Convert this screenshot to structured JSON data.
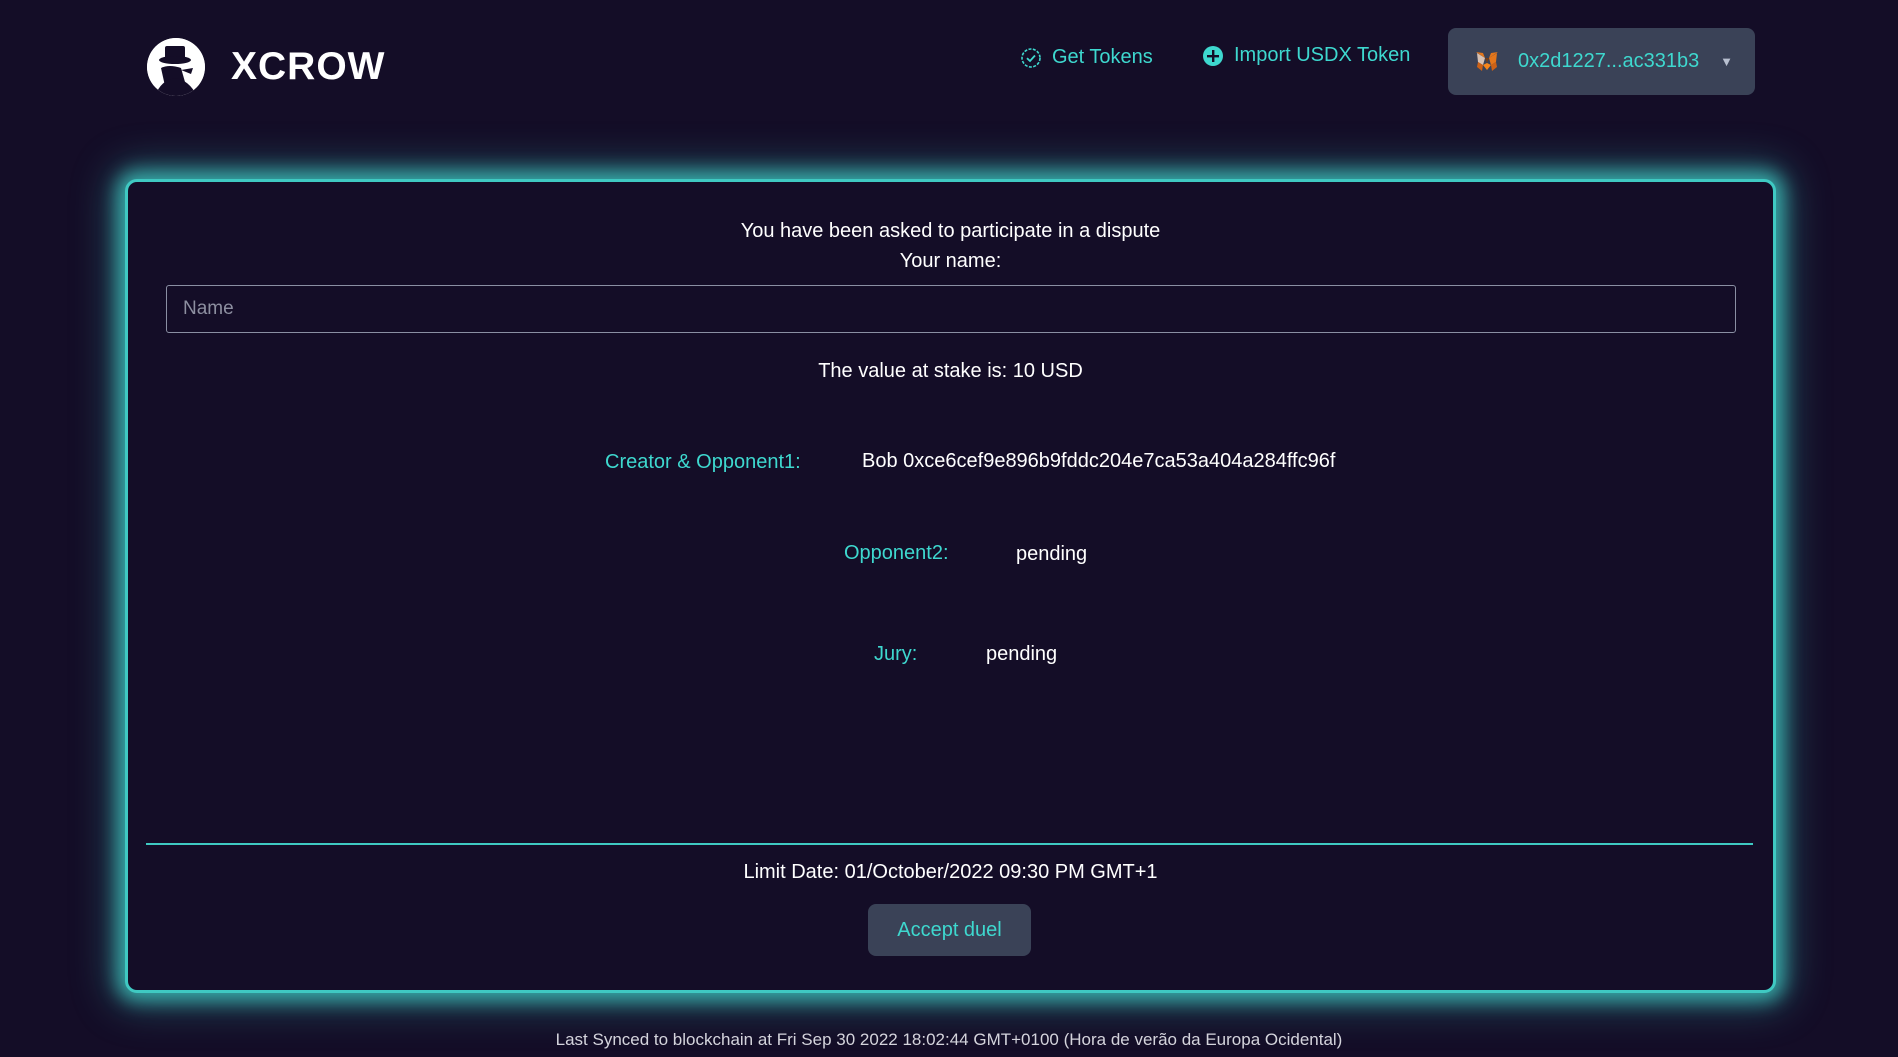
{
  "header": {
    "brand_name": "XCROW",
    "get_tokens_label": "Get Tokens",
    "import_token_label": "Import USDX Token",
    "wallet_address": "0x2d1227...ac331b3"
  },
  "dispute": {
    "intro_line1": "You have been asked to participate in a dispute",
    "intro_line2": "Your name:",
    "name_placeholder": "Name",
    "stake_text": "The value at stake is: 10 USD",
    "creator_label": "Creator & Opponent1:",
    "creator_value": "Bob 0xce6cef9e896b9fddc204e7ca53a404a284ffc96f",
    "opponent2_label": "Opponent2:",
    "opponent2_value": "pending",
    "jury_label": "Jury:",
    "jury_value": "pending",
    "limit_date": "Limit Date: 01/October/2022 09:30 PM GMT+1",
    "accept_label": "Accept duel"
  },
  "footer": {
    "sync_text": "Last Synced to blockchain at Fri Sep 30 2022 18:02:44 GMT+0100 (Hora de verão da Europa Ocidental)"
  },
  "theme": {
    "background": "#140d27",
    "accent": "#3ed8cf",
    "button_bg": "#3a4257"
  },
  "icons": {
    "logo": "detective-hat-logo-icon",
    "get_tokens": "check-circle-icon",
    "import_token": "plus-circle-icon",
    "wallet": "metamask-fox-icon",
    "dropdown": "caret-down-icon"
  }
}
